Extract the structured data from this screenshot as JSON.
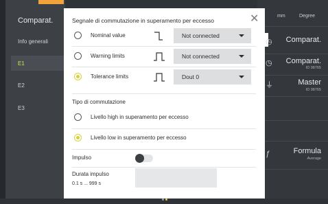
{
  "left_nav": {
    "title": "Comparat.",
    "items": [
      {
        "label": "Info generali",
        "active": false
      },
      {
        "label": "E1",
        "active": true
      },
      {
        "label": "E2",
        "active": false
      },
      {
        "label": "E3",
        "active": false
      }
    ]
  },
  "right_panel": {
    "units": [
      "mm",
      "Degree"
    ],
    "items": [
      {
        "title": "Comparat.",
        "subtitle": "",
        "icon": "gauge-icon"
      },
      {
        "title": "Comparat.",
        "subtitle": "ID 98765",
        "icon": "gauge-icon"
      },
      {
        "title": "Master",
        "subtitle": "ID 98765",
        "icon": "master-icon"
      },
      {
        "title": "Formula",
        "subtitle": "Average",
        "icon": "formula-icon"
      }
    ]
  },
  "dialog": {
    "title": "Segnale di commutazione in superamento per eccesso",
    "signal_rows": [
      {
        "label": "Nominal value",
        "selected": false,
        "select_value": "Not connected",
        "signal_icon": "step-signal-icon"
      },
      {
        "label": "Warning limits",
        "selected": false,
        "select_value": "Not connected",
        "signal_icon": "pulse-signal-icon"
      },
      {
        "label": "Tolerance limits",
        "selected": true,
        "select_value": "Dout 0",
        "signal_icon": "pulse-signal-icon"
      }
    ],
    "switch_type": {
      "label": "Tipo di commutazione",
      "options": [
        {
          "label": "Livello high in superamento per eccesso",
          "selected": false
        },
        {
          "label": "Livello low in superamento per eccesso",
          "selected": true
        }
      ]
    },
    "pulse": {
      "label": "Impulso",
      "enabled": false
    },
    "pulse_duration": {
      "label": "Durata impulso",
      "range": "0.1 s ... 999 s",
      "value": ""
    },
    "page_dots": 2,
    "active_dot": 1
  },
  "colors": {
    "accent": "#d8d23a",
    "orange": "#f2a43a",
    "sidebar": "#3d4045",
    "dialog_bg": "#ffffff",
    "select_bg": "#dcdedf"
  }
}
